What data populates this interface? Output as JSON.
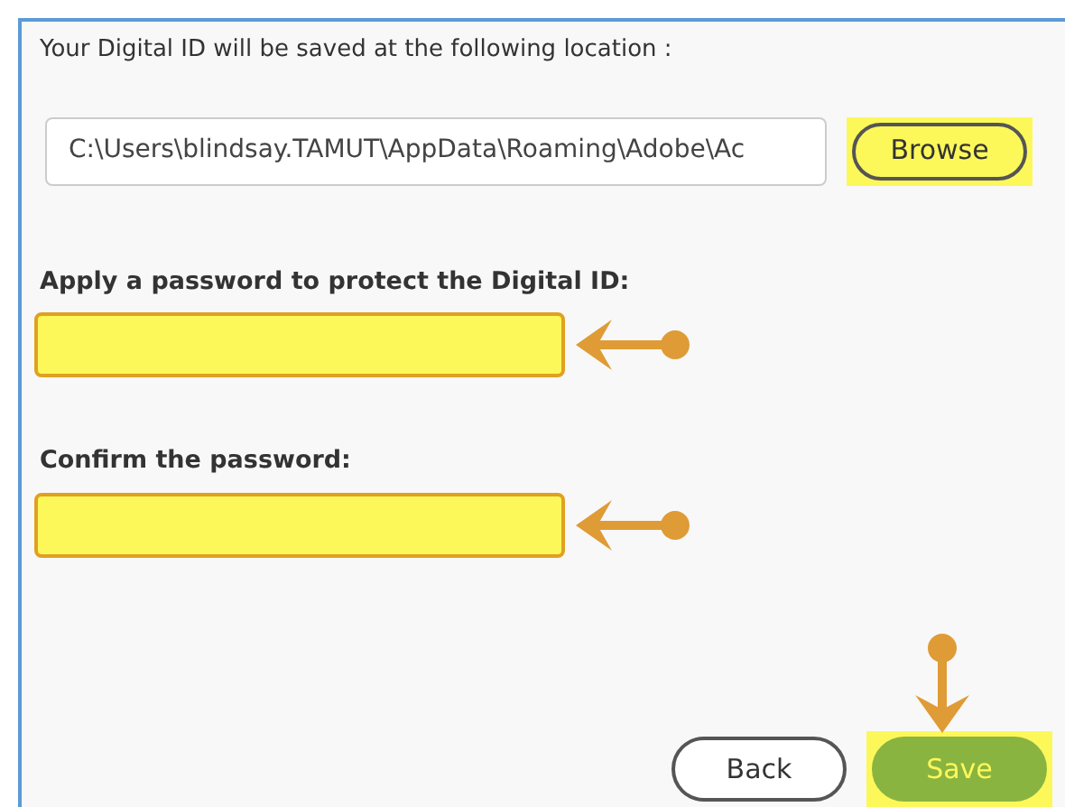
{
  "location_label": "Your Digital ID will be saved at the following location :",
  "location_path": {
    "value": "C:\\Users\\blindsay.TAMUT\\AppData\\Roaming\\Adobe\\Ac",
    "highlighted": false
  },
  "browse_button": {
    "label": "Browse",
    "highlighted": true
  },
  "password_fields": [
    {
      "label": "Apply a password to protect the Digital ID:",
      "highlighted": true,
      "pointed_at": true
    },
    {
      "label": "Confirm the password:",
      "highlighted": true,
      "pointed_at": true
    }
  ],
  "buttons": [
    {
      "label": "Back",
      "kind": "secondary",
      "highlighted": false
    },
    {
      "label": "Save",
      "kind": "primary",
      "highlighted": true,
      "pointed_at": true
    }
  ]
}
